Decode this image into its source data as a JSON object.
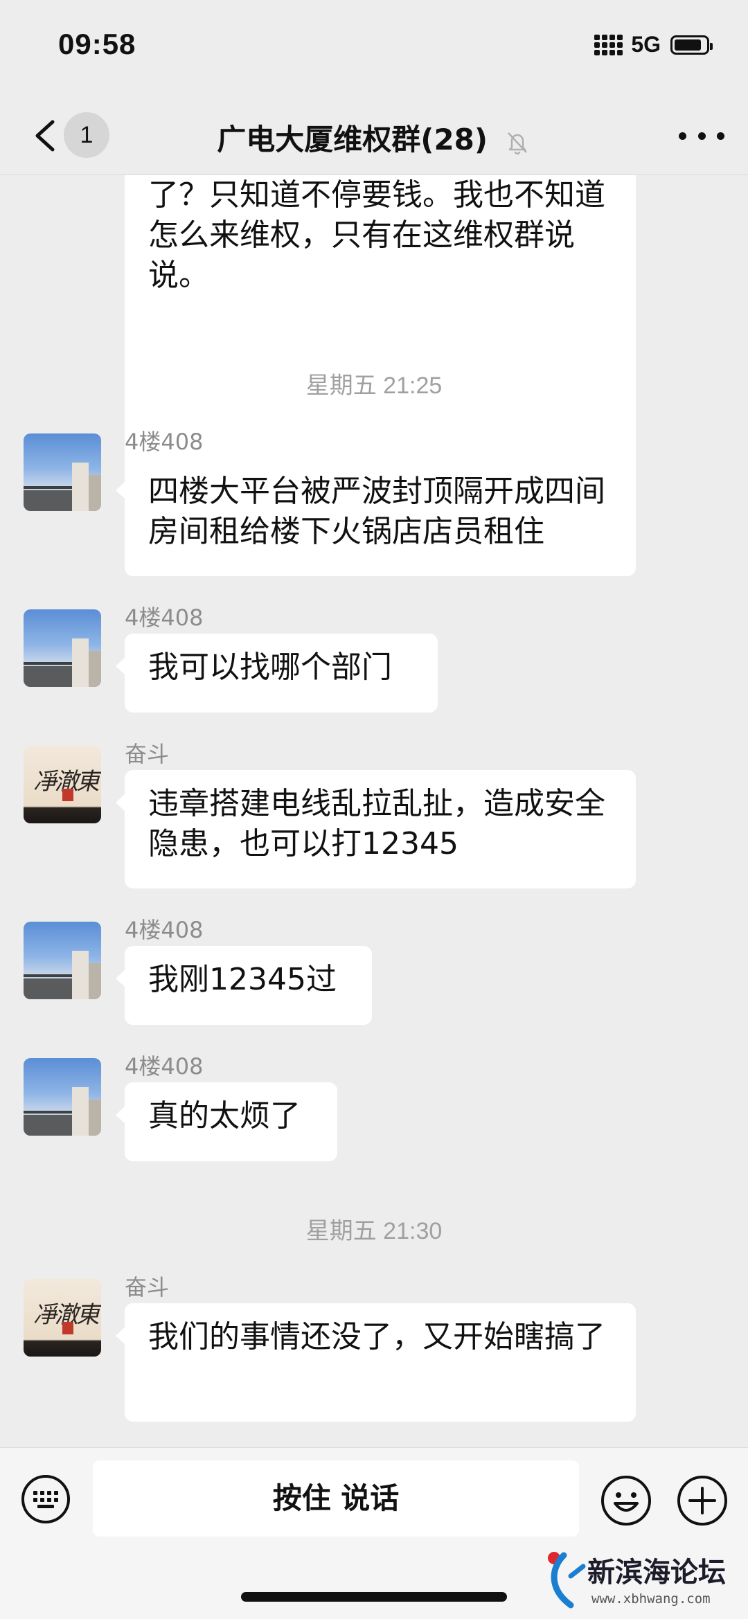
{
  "status_bar": {
    "time": "09:58",
    "network": "5G"
  },
  "header": {
    "unread_count": "1",
    "title": "广电大厦维权群(28)"
  },
  "messages": [
    {
      "type": "text",
      "text": "了？只知道不停要钱。我也不知道怎么来维权，只有在这维权群说说。"
    },
    {
      "type": "time",
      "text": "星期五 21:25"
    },
    {
      "type": "text",
      "sender": "4楼408",
      "avatar": "building-photo",
      "text": "四楼大平台被严波封顶隔开成四间房间租给楼下火锅店店员租住"
    },
    {
      "type": "text",
      "sender": "4楼408",
      "avatar": "building-photo",
      "text": "我可以找哪个部门"
    },
    {
      "type": "text",
      "sender": "奋斗",
      "avatar": "calligraphy",
      "text": "违章搭建电线乱拉乱扯，造成安全隐患，也可以打12345"
    },
    {
      "type": "text",
      "sender": "4楼408",
      "avatar": "building-photo",
      "text": "我刚12345过"
    },
    {
      "type": "text",
      "sender": "4楼408",
      "avatar": "building-photo",
      "text": "真的太烦了"
    },
    {
      "type": "time",
      "text": "星期五 21:30"
    },
    {
      "type": "text",
      "sender": "奋斗",
      "avatar": "calligraphy",
      "text": "我们的事情还没了，又开始瞎搞了"
    }
  ],
  "input_bar": {
    "voice_label": "按住 说话"
  },
  "watermark": {
    "text": "新滨海论坛",
    "url": "www.xbhwang.com"
  },
  "colors": {
    "background": "#ededed",
    "bubble": "#ffffff",
    "timestamp": "#a0a0a0",
    "nickname": "#8c8c8c"
  }
}
